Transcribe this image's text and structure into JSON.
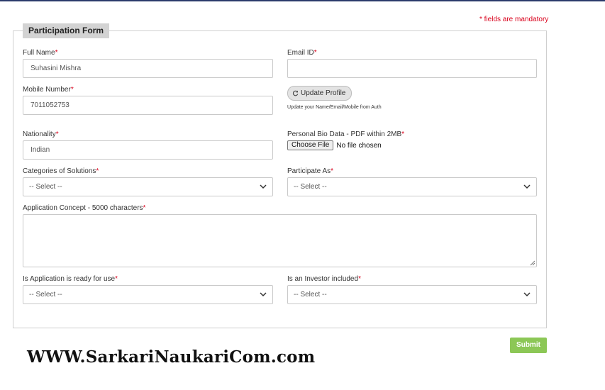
{
  "mandatory_note": "* fields are mandatory",
  "form": {
    "legend": "Participation Form",
    "full_name": {
      "label": "Full Name",
      "required": "*",
      "value": "Suhasini Mishra"
    },
    "email": {
      "label": "Email ID",
      "required": "*",
      "value": ""
    },
    "mobile": {
      "label": "Mobile Number",
      "required": "*",
      "value": "7011052753"
    },
    "update_profile": {
      "label": "Update Profile",
      "note": "Update your Name/Email/Mobile from Auth",
      "icon": "refresh-icon"
    },
    "nationality": {
      "label": "Nationality",
      "required": "*",
      "value": "Indian"
    },
    "bio_data": {
      "label": "Personal Bio Data - PDF within 2MB",
      "required": "*",
      "button": "Choose File",
      "status": "No file chosen"
    },
    "categories": {
      "label": "Categories of Solutions",
      "required": "*",
      "selected": "-- Select --"
    },
    "participate_as": {
      "label": "Participate As",
      "required": "*",
      "selected": "-- Select --"
    },
    "concept": {
      "label": "Application Concept - 5000 characters",
      "required": "*",
      "value": ""
    },
    "app_ready": {
      "label": "Is Application is ready for use",
      "required": "*",
      "selected": "-- Select --"
    },
    "investor": {
      "label": "Is an Investor included",
      "required": "*",
      "selected": "-- Select --"
    },
    "submit_label": "Submit"
  },
  "watermark": "WWW.SarkariNaukariCom.com",
  "colors": {
    "required": "#d9001b",
    "submit": "#8cc756",
    "topbar": "#2b3a6b"
  }
}
